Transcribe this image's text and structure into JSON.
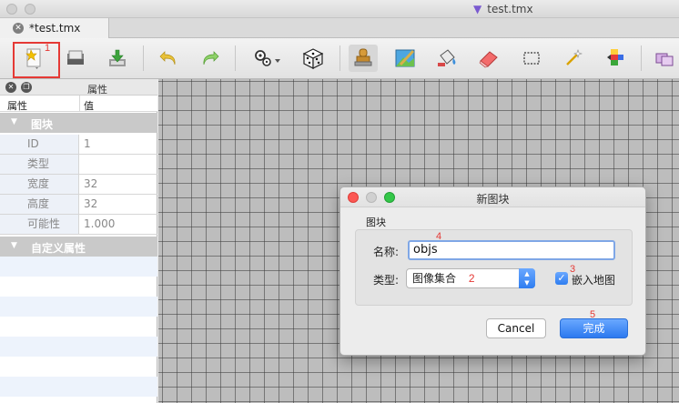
{
  "window": {
    "title": "test.tmx"
  },
  "tabs": [
    {
      "label": "*test.tmx"
    }
  ],
  "annotations": {
    "a1": "1",
    "a2": "2",
    "a3": "3",
    "a4": "4",
    "a5": "5"
  },
  "properties_panel": {
    "title": "属性",
    "col_name": "属性",
    "col_value": "值",
    "group_tileset": "图块",
    "rows": [
      {
        "key": "ID",
        "value": "1"
      },
      {
        "key": "类型",
        "value": ""
      },
      {
        "key": "宽度",
        "value": "32"
      },
      {
        "key": "高度",
        "value": "32"
      },
      {
        "key": "可能性",
        "value": "1.000"
      }
    ],
    "group_custom": "自定义属性"
  },
  "dialog": {
    "title": "新图块",
    "group_label": "图块",
    "name_label": "名称:",
    "name_value": "objs",
    "type_label": "类型:",
    "type_value": "图像集合",
    "embed_label": "嵌入地图",
    "embed_checked": true,
    "cancel_label": "Cancel",
    "ok_label": "完成"
  },
  "colors": {
    "annotation": "#e53935",
    "accent": "#2f7df0"
  }
}
